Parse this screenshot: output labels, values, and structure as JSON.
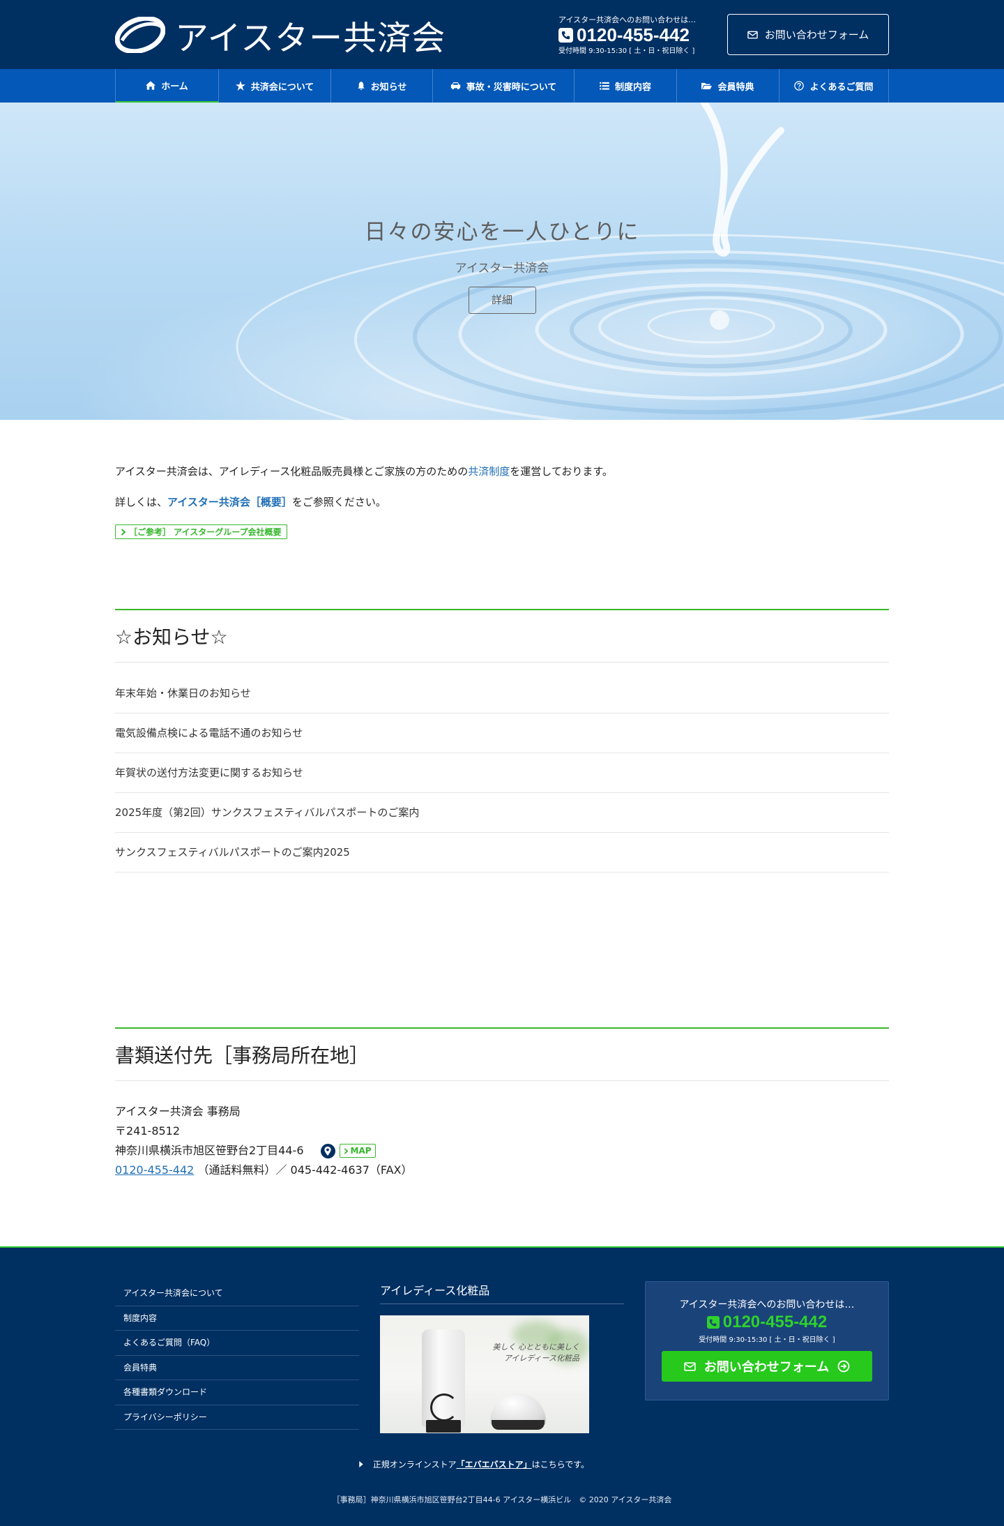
{
  "header": {
    "logo_text": "アイスター共済会",
    "contact_lead": "アイスター共済会へのお問い合わせは…",
    "phone": "0120-455-442",
    "hours": "受付時間 9:30-15:30 [ 土・日・祝日除く ]",
    "contact_button": "お問い合わせフォーム"
  },
  "nav": {
    "items": [
      {
        "label": "ホーム",
        "icon": "home-icon"
      },
      {
        "label": "共済会について",
        "icon": "star-icon"
      },
      {
        "label": "お知らせ",
        "icon": "bell-icon"
      },
      {
        "label": "事故・災害時について",
        "icon": "car-icon"
      },
      {
        "label": "制度内容",
        "icon": "list-icon"
      },
      {
        "label": "会員特典",
        "icon": "folder-icon"
      },
      {
        "label": "よくあるご質問",
        "icon": "question-icon"
      }
    ]
  },
  "hero": {
    "title": "日々の安心を一人ひとりに",
    "subtitle": "アイスター共済会",
    "button": "詳細"
  },
  "intro": {
    "p1_before": "アイスター共済会は、アイレディース化粧品販売員様とご家族の方のための",
    "p1_link": "共済制度",
    "p1_after": "を運営しております。",
    "p2_before": "詳しくは、",
    "p2_link": "アイスター共済会［概要］",
    "p2_after": "をご参照ください。",
    "ref_button": "［ご参考］ アイスターグループ会社概要"
  },
  "news": {
    "title": "☆お知らせ☆",
    "items": [
      "年末年始・休業日のお知らせ",
      "電気設備点検による電話不通のお知らせ",
      "年賀状の送付方法変更に関するお知らせ",
      "2025年度（第2回）サンクスフェスティバルパスポートのご案内",
      "サンクスフェスティバルパスポートのご案内2025"
    ]
  },
  "address": {
    "title": "書類送付先［事務局所在地］",
    "name": "アイスター共済会 事務局",
    "postal": "〒241-8512",
    "address": "神奈川県横浜市旭区笹野台2丁目44-6",
    "map_label": "MAP",
    "tel": "0120-455-442",
    "tel_rest": "（通話料無料）／ 045-442-4637（FAX）"
  },
  "footer": {
    "nav": [
      "アイスター共済会について",
      "制度内容",
      "よくあるご質問（FAQ）",
      "会員特典",
      "各種書類ダウンロード",
      "プライバシーポリシー"
    ],
    "product_title": "アイレディース化粧品",
    "product_copy_1": "美しく 心とともに美しく",
    "product_copy_2": "アイレディース化粧品",
    "contact_lead": "アイスター共済会へのお問い合わせは…",
    "phone": "0120-455-442",
    "hours": "受付時間 9:30-15:30 [ 土・日・祝日除く ]",
    "form_button": "お問い合わせフォーム",
    "store_before": "正規オンラインストア",
    "store_link": "「エバエバストア」",
    "store_after": "はこちらです。",
    "copyright": "［事務局］神奈川県横浜市旭区笹野台2丁目44-6 アイスター横浜ビル　© 2020 アイスター共済会"
  },
  "colors": {
    "header_bg": "#002f62",
    "nav_bg": "#0458b7",
    "accent_green": "#35b72b",
    "link_blue": "#1f6fb6"
  }
}
